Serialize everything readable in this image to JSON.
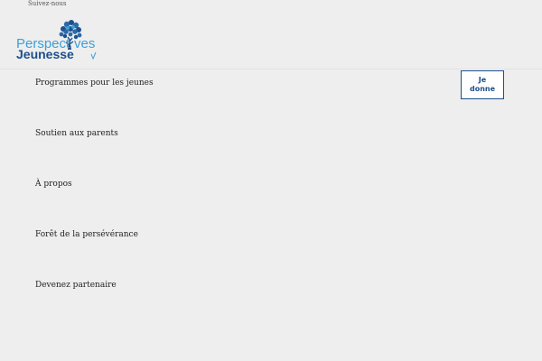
{
  "header": {
    "follow_text": "Suivez-nous",
    "logo": {
      "word1_part1": "Perspect",
      "word1_part2": "ves",
      "word2": "Jeunesse",
      "icon": "tree-icon",
      "colors": {
        "light_blue": "#3aa0d8",
        "dark_blue": "#1d4f8c"
      }
    }
  },
  "nav": {
    "items": [
      {
        "label": "Programmes pour les jeunes"
      },
      {
        "label": "Soutien aux parents"
      },
      {
        "label": "À propos"
      },
      {
        "label": "Forêt de la persévérance"
      },
      {
        "label": "Devenez partenaire"
      }
    ]
  },
  "donate": {
    "label": "Je donne",
    "color": "#1d4f8c"
  }
}
